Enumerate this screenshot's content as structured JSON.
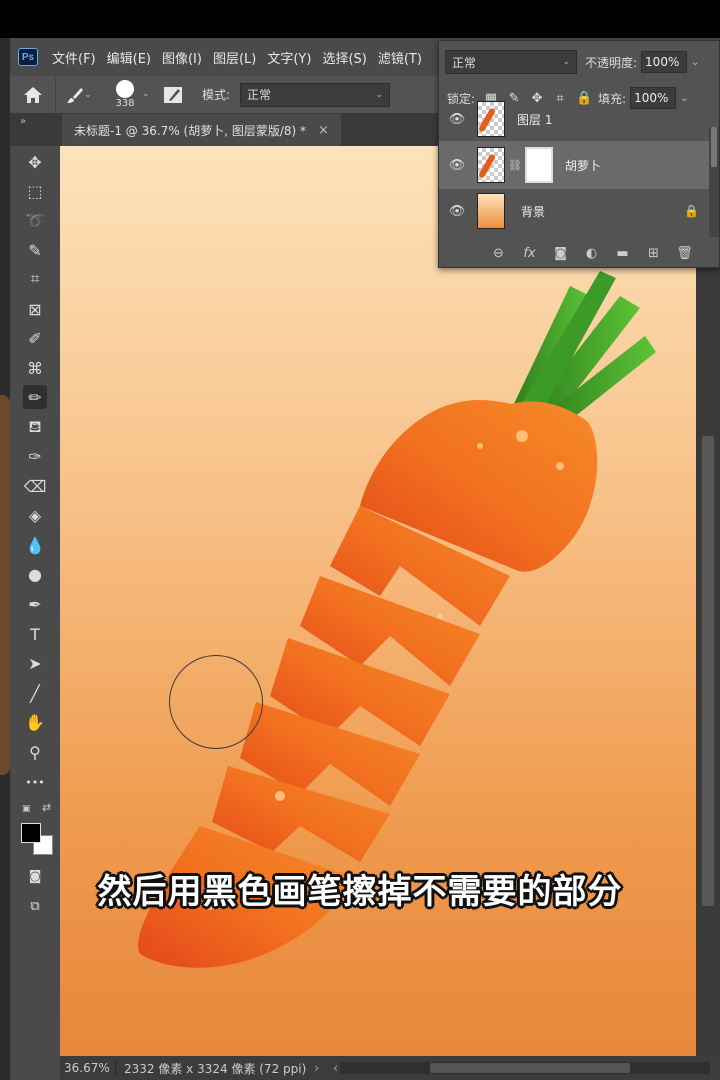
{
  "app": {
    "logo": "Ps"
  },
  "menu": [
    "文件(F)",
    "编辑(E)",
    "图像(I)",
    "图层(L)",
    "文字(Y)",
    "选择(S)",
    "滤镜(T)"
  ],
  "options": {
    "brush_size": "338",
    "mode_label": "模式:",
    "mode_value": "正常"
  },
  "tab": {
    "collapse": "»",
    "title": "未标题-1 @ 36.7% (胡萝卜, 图层蒙版/8) *",
    "close": "×"
  },
  "tools": [
    {
      "name": "move-tool",
      "glyph": "✥"
    },
    {
      "name": "marquee-tool",
      "glyph": "⬚"
    },
    {
      "name": "lasso-tool",
      "glyph": "➰"
    },
    {
      "name": "quick-select-tool",
      "glyph": "✎"
    },
    {
      "name": "crop-tool",
      "glyph": "⌗"
    },
    {
      "name": "frame-tool",
      "glyph": "⊠"
    },
    {
      "name": "eyedropper-tool",
      "glyph": "✐"
    },
    {
      "name": "healing-brush-tool",
      "glyph": "⌘"
    },
    {
      "name": "brush-tool",
      "glyph": "✏"
    },
    {
      "name": "clone-stamp-tool",
      "glyph": "⛾"
    },
    {
      "name": "history-brush-tool",
      "glyph": "✑"
    },
    {
      "name": "eraser-tool",
      "glyph": "⌫"
    },
    {
      "name": "paint-bucket-tool",
      "glyph": "◈"
    },
    {
      "name": "blur-tool",
      "glyph": "💧"
    },
    {
      "name": "dodge-tool",
      "glyph": "●"
    },
    {
      "name": "pen-tool",
      "glyph": "✒"
    },
    {
      "name": "type-tool",
      "glyph": "T"
    },
    {
      "name": "path-select-tool",
      "glyph": "➤"
    },
    {
      "name": "line-tool",
      "glyph": "╱"
    },
    {
      "name": "hand-tool",
      "glyph": "✋"
    },
    {
      "name": "zoom-tool",
      "glyph": "⚲"
    },
    {
      "name": "more-tools",
      "glyph": "•••"
    }
  ],
  "subtitle": "然后用黑色画笔擦掉不需要的部分",
  "status": {
    "zoom": "36.67%",
    "doc_info": "2332 像素 x 3324 像素 (72 ppi)",
    "arrow": "›",
    "arrow_left": "‹"
  },
  "layers_panel": {
    "blend_mode": "正常",
    "opacity_label": "不透明度:",
    "opacity": "100%",
    "lock_label": "锁定:",
    "fill_label": "填充:",
    "fill": "100%",
    "layers": [
      {
        "name": "图层 1",
        "selected": false
      },
      {
        "name": "胡萝卜",
        "selected": true
      },
      {
        "name": "背景",
        "selected": false
      }
    ],
    "footer_icons": [
      "link-icon",
      "fx-icon",
      "mask-icon",
      "adjustment-icon",
      "folder-icon",
      "new-layer-icon",
      "trash-icon"
    ],
    "fx": "fx"
  },
  "colors": {
    "accent": "#6aa9e6",
    "carrot": "#e45d1c",
    "leaf": "#3f9a27"
  }
}
